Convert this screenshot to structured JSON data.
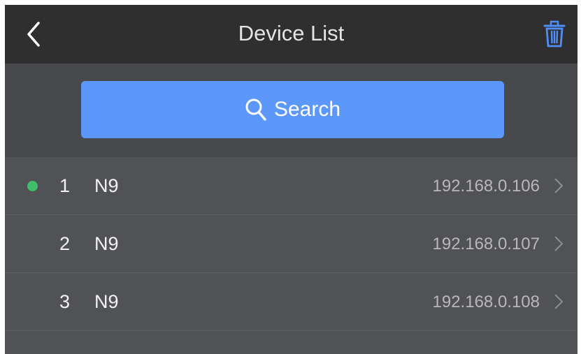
{
  "header": {
    "title": "Device List",
    "back_icon": "chevron-left-icon",
    "delete_icon": "trash-icon",
    "accent_color": "#5c97fa"
  },
  "search": {
    "label": "Search",
    "icon": "search-icon",
    "color": "#5c97fa"
  },
  "devices": [
    {
      "index": "1",
      "name": "N9",
      "ip": "192.168.0.106",
      "connected": true
    },
    {
      "index": "2",
      "name": "N9",
      "ip": "192.168.0.107",
      "connected": false
    },
    {
      "index": "3",
      "name": "N9",
      "ip": "192.168.0.108",
      "connected": false
    }
  ],
  "status_color_connected": "#3fbd6a"
}
